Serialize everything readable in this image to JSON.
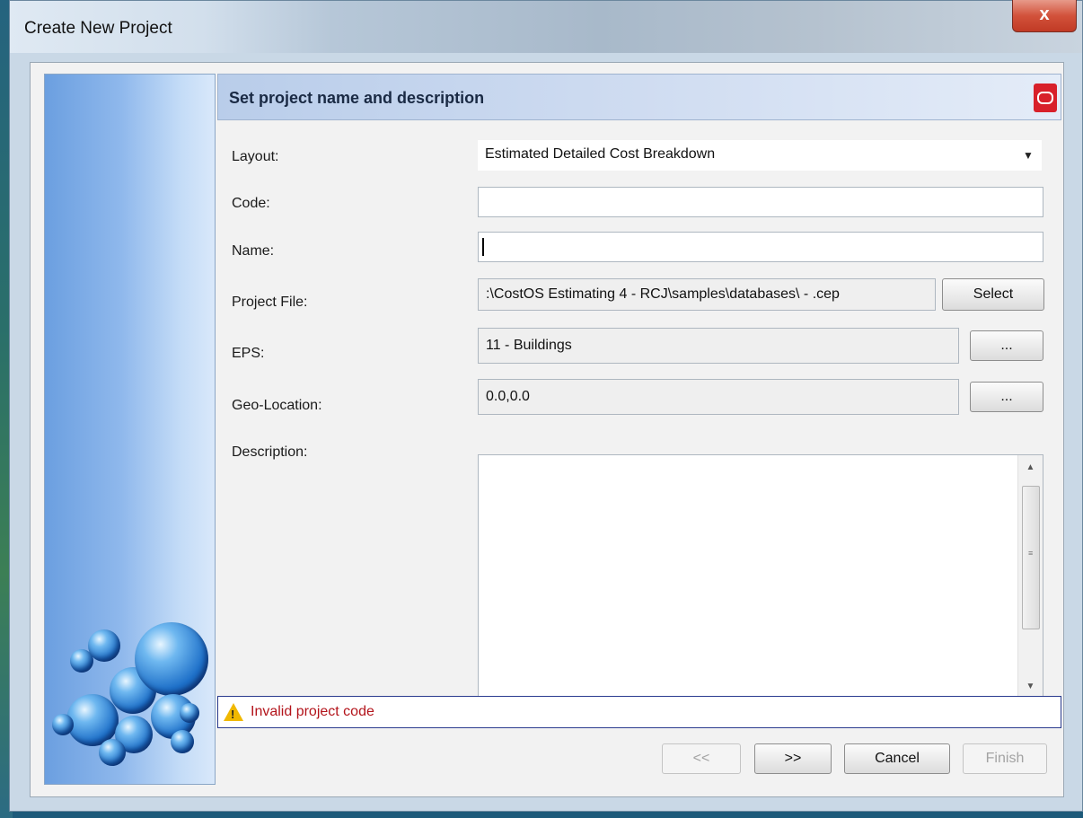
{
  "window": {
    "title": "Create New Project",
    "close_label": "x"
  },
  "header": {
    "title": "Set project name and description",
    "icon": "oracle-icon"
  },
  "form": {
    "layout": {
      "label": "Layout:",
      "value": "Estimated Detailed Cost Breakdown"
    },
    "code": {
      "label": "Code:",
      "value": ""
    },
    "name": {
      "label": "Name:",
      "value": ""
    },
    "project_file": {
      "label": "Project File:",
      "value": ":\\CostOS Estimating 4 - RCJ\\samples\\databases\\ - .cep",
      "button": "Select"
    },
    "eps": {
      "label": "EPS:",
      "value": "11 - Buildings",
      "button": "..."
    },
    "geo_location": {
      "label": "Geo-Location:",
      "value": "0.0,0.0",
      "button": "..."
    },
    "description": {
      "label": "Description:",
      "value": ""
    }
  },
  "status": {
    "icon": "warning-icon",
    "message": "Invalid project code"
  },
  "buttons": {
    "back": "<<",
    "next": ">>",
    "cancel": "Cancel",
    "finish": "Finish"
  },
  "colors": {
    "error_text": "#b3141b",
    "header_accent": "#d8202a"
  }
}
